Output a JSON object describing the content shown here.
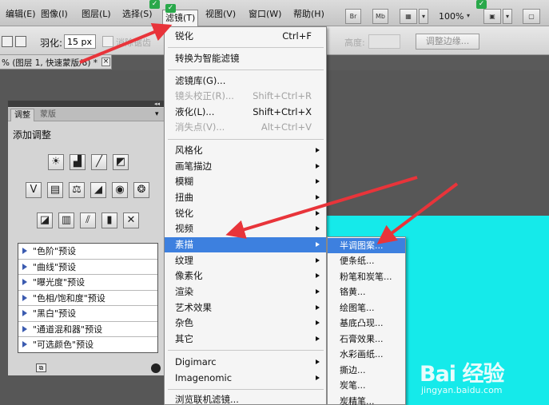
{
  "menubar": {
    "items": [
      {
        "label": "编辑(E)",
        "active": false
      },
      {
        "label": "图像(I)",
        "active": false
      },
      {
        "label": "图层(L)",
        "active": false
      },
      {
        "label": "选择(S)",
        "active": false
      },
      {
        "label": "滤镜(T)",
        "active": true
      },
      {
        "label": "视图(V)",
        "active": false
      },
      {
        "label": "窗口(W)",
        "active": false
      },
      {
        "label": "帮助(H)",
        "active": false
      }
    ],
    "app_icons": [
      "Br",
      "Mb"
    ],
    "zoom": "100%"
  },
  "options": {
    "feather_label": "羽化:",
    "feather_value": "15 px",
    "antialias_label": "消除锯齿",
    "height_label": "高度:",
    "refine_edge_label": "调整边缘..."
  },
  "document_tab": {
    "label": "% (图层 1, 快速蒙版/8) *",
    "close": "×"
  },
  "adjustments_panel": {
    "tabs": [
      "调整",
      "蒙版"
    ],
    "title": "添加调整",
    "icons_row1": [
      "brightness-contrast-icon",
      "levels-icon",
      "curves-icon",
      "exposure-icon"
    ],
    "icons_row2": [
      "vibrance-icon",
      "hue-saturation-icon",
      "color-balance-icon",
      "black-white-icon",
      "photo-filter-icon",
      "channel-mixer-icon"
    ],
    "icons_row3": [
      "invert-icon",
      "posterize-icon",
      "threshold-icon",
      "gradient-map-icon",
      "selective-color-icon"
    ],
    "presets": [
      "\"色阶\"预设",
      "\"曲线\"预设",
      "\"曝光度\"预设",
      "\"色相/饱和度\"预设",
      "\"黑白\"预设",
      "\"通道混和器\"预设",
      "\"可选颜色\"预设"
    ]
  },
  "filter_menu": {
    "top": [
      {
        "label": "锐化",
        "shortcut": "Ctrl+F",
        "disabled": false
      }
    ],
    "convert": {
      "label": "转换为智能滤镜"
    },
    "gallery": [
      {
        "label": "滤镜库(G)...",
        "shortcut": "",
        "disabled": false
      },
      {
        "label": "镜头校正(R)...",
        "shortcut": "Shift+Ctrl+R",
        "disabled": true
      },
      {
        "label": "液化(L)...",
        "shortcut": "Shift+Ctrl+X",
        "disabled": false
      },
      {
        "label": "消失点(V)...",
        "shortcut": "Alt+Ctrl+V",
        "disabled": true
      }
    ],
    "categories": [
      {
        "label": "风格化",
        "highlight": false
      },
      {
        "label": "画笔描边",
        "highlight": false
      },
      {
        "label": "模糊",
        "highlight": false
      },
      {
        "label": "扭曲",
        "highlight": false
      },
      {
        "label": "锐化",
        "highlight": false
      },
      {
        "label": "视频",
        "highlight": false
      },
      {
        "label": "素描",
        "highlight": true
      },
      {
        "label": "纹理",
        "highlight": false
      },
      {
        "label": "像素化",
        "highlight": false
      },
      {
        "label": "渲染",
        "highlight": false
      },
      {
        "label": "艺术效果",
        "highlight": false
      },
      {
        "label": "杂色",
        "highlight": false
      },
      {
        "label": "其它",
        "highlight": false
      }
    ],
    "plugins": [
      {
        "label": "Digimarc"
      },
      {
        "label": "Imagenomic"
      }
    ],
    "browse": {
      "label": "浏览联机滤镜..."
    }
  },
  "sketch_submenu": {
    "items": [
      {
        "label": "半调图案...",
        "highlight": true
      },
      {
        "label": "便条纸...",
        "highlight": false
      },
      {
        "label": "粉笔和炭笔...",
        "highlight": false
      },
      {
        "label": "铬黄...",
        "highlight": false
      },
      {
        "label": "绘图笔...",
        "highlight": false
      },
      {
        "label": "基底凸现...",
        "highlight": false
      },
      {
        "label": "石膏效果...",
        "highlight": false
      },
      {
        "label": "水彩画纸...",
        "highlight": false
      },
      {
        "label": "撕边...",
        "highlight": false
      },
      {
        "label": "炭笔...",
        "highlight": false
      },
      {
        "label": "炭精笔...",
        "highlight": false
      }
    ]
  },
  "watermark": {
    "logo": "Bai  经验",
    "url": "jingyan.baidu.com"
  },
  "colors": {
    "canvas": "#15eaea",
    "highlight": "#3d80df",
    "arrow": "#e8343a",
    "preset_triangle": "#3b5bb0"
  }
}
